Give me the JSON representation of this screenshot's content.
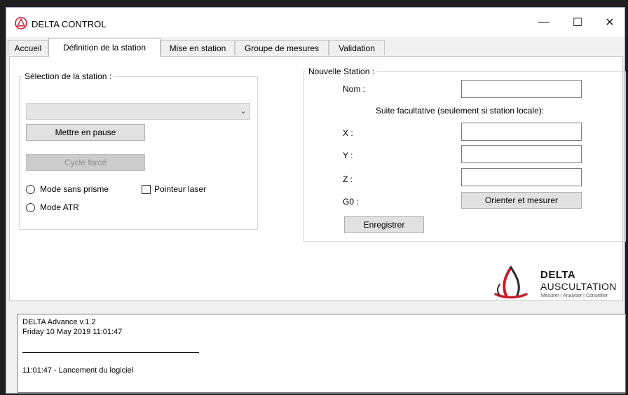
{
  "window": {
    "title": "DELTA CONTROL",
    "controls": {
      "minimize": "—",
      "maximize": "☐",
      "close": "✕"
    }
  },
  "tabs": [
    {
      "label": "Accueil",
      "active": false
    },
    {
      "label": "Définition de la station",
      "active": true
    },
    {
      "label": "Mise en station",
      "active": false
    },
    {
      "label": "Groupe de mesures",
      "active": false
    },
    {
      "label": "Validation",
      "active": false
    }
  ],
  "station_selection": {
    "legend": "Sélection de la station :",
    "dropdown": {
      "value": "",
      "enabled": false
    },
    "pause_button": "Mettre en pause",
    "forced_cycle_button": "Cycle forcé",
    "forced_cycle_enabled": false,
    "options": {
      "prismless": {
        "label": "Mode sans prisme",
        "checked": false
      },
      "laser_pointer": {
        "label": "Pointeur laser",
        "checked": false
      },
      "atr": {
        "label": "Mode ATR",
        "checked": false
      }
    }
  },
  "new_station": {
    "legend": "Nouvelle Station :",
    "name_label": "Nom :",
    "name_value": "",
    "optional_note": "Suite facultative (seulement si station locale):",
    "x_label": "X :",
    "x_value": "",
    "y_label": "Y :",
    "y_value": "",
    "z_label": "Z :",
    "z_value": "",
    "g0_label": "G0 :",
    "orient_button": "Orienter et mesurer",
    "save_button": "Enregistrer"
  },
  "logo": {
    "title": "DELTA",
    "subtitle": "AUSCULTATION",
    "tagline": "Mesurer | Analyser | Conseiller",
    "colors": {
      "red": "#c8202f",
      "dark": "#2a2a2a"
    }
  },
  "log": {
    "version_line": "DELTA Advance v.1.2",
    "date_line": "Friday 10 May 2019 11:01:47",
    "entry_line": "11:01:47  -  Lancement du logiciel"
  }
}
